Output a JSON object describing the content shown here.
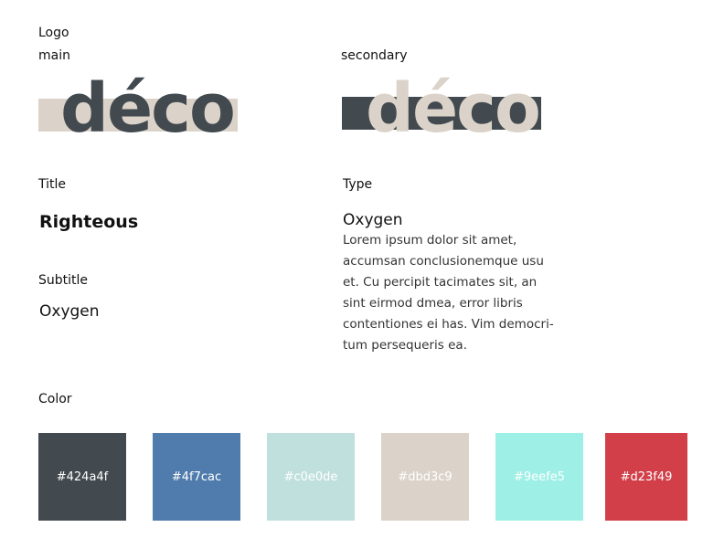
{
  "sections": {
    "logo": "Logo",
    "title": "Title",
    "type": "Type",
    "subtitle": "Subtitle",
    "color": "Color"
  },
  "logos": [
    {
      "label": "main",
      "word": "déco",
      "bar_color": "#dbd3c9",
      "text_color": "#424a4f"
    },
    {
      "label": "secondary",
      "word": "déco",
      "bar_color": "#424a4f",
      "text_color": "#dbd3c9"
    }
  ],
  "title_font": "Righteous",
  "subtitle_font": "Oxygen",
  "type": {
    "font": "Oxygen",
    "body_lines": [
      "Lorem ipsum dolor sit amet,",
      "accumsan conclusionemque usu",
      "et. Cu percipit tacimates sit, an",
      "sint eirmod dmea, error libris",
      "contentiones ei has. Vim democri-",
      "tum persequeris ea."
    ]
  },
  "colors": [
    {
      "hex": "#424a4f",
      "label": "#424a4f",
      "text": "#ffffff"
    },
    {
      "hex": "#4f7cac",
      "label": "#4f7cac",
      "text": "#ffffff"
    },
    {
      "hex": "#c0e0de",
      "label": "#c0e0de",
      "text": "#ffffff"
    },
    {
      "hex": "#dbd3c9",
      "label": "#dbd3c9",
      "text": "#ffffff"
    },
    {
      "hex": "#9eefe5",
      "label": "#9eefe5",
      "text": "#ffffff"
    },
    {
      "hex": "#d23f49",
      "label": "#d23f49",
      "text": "#ffffff"
    }
  ]
}
